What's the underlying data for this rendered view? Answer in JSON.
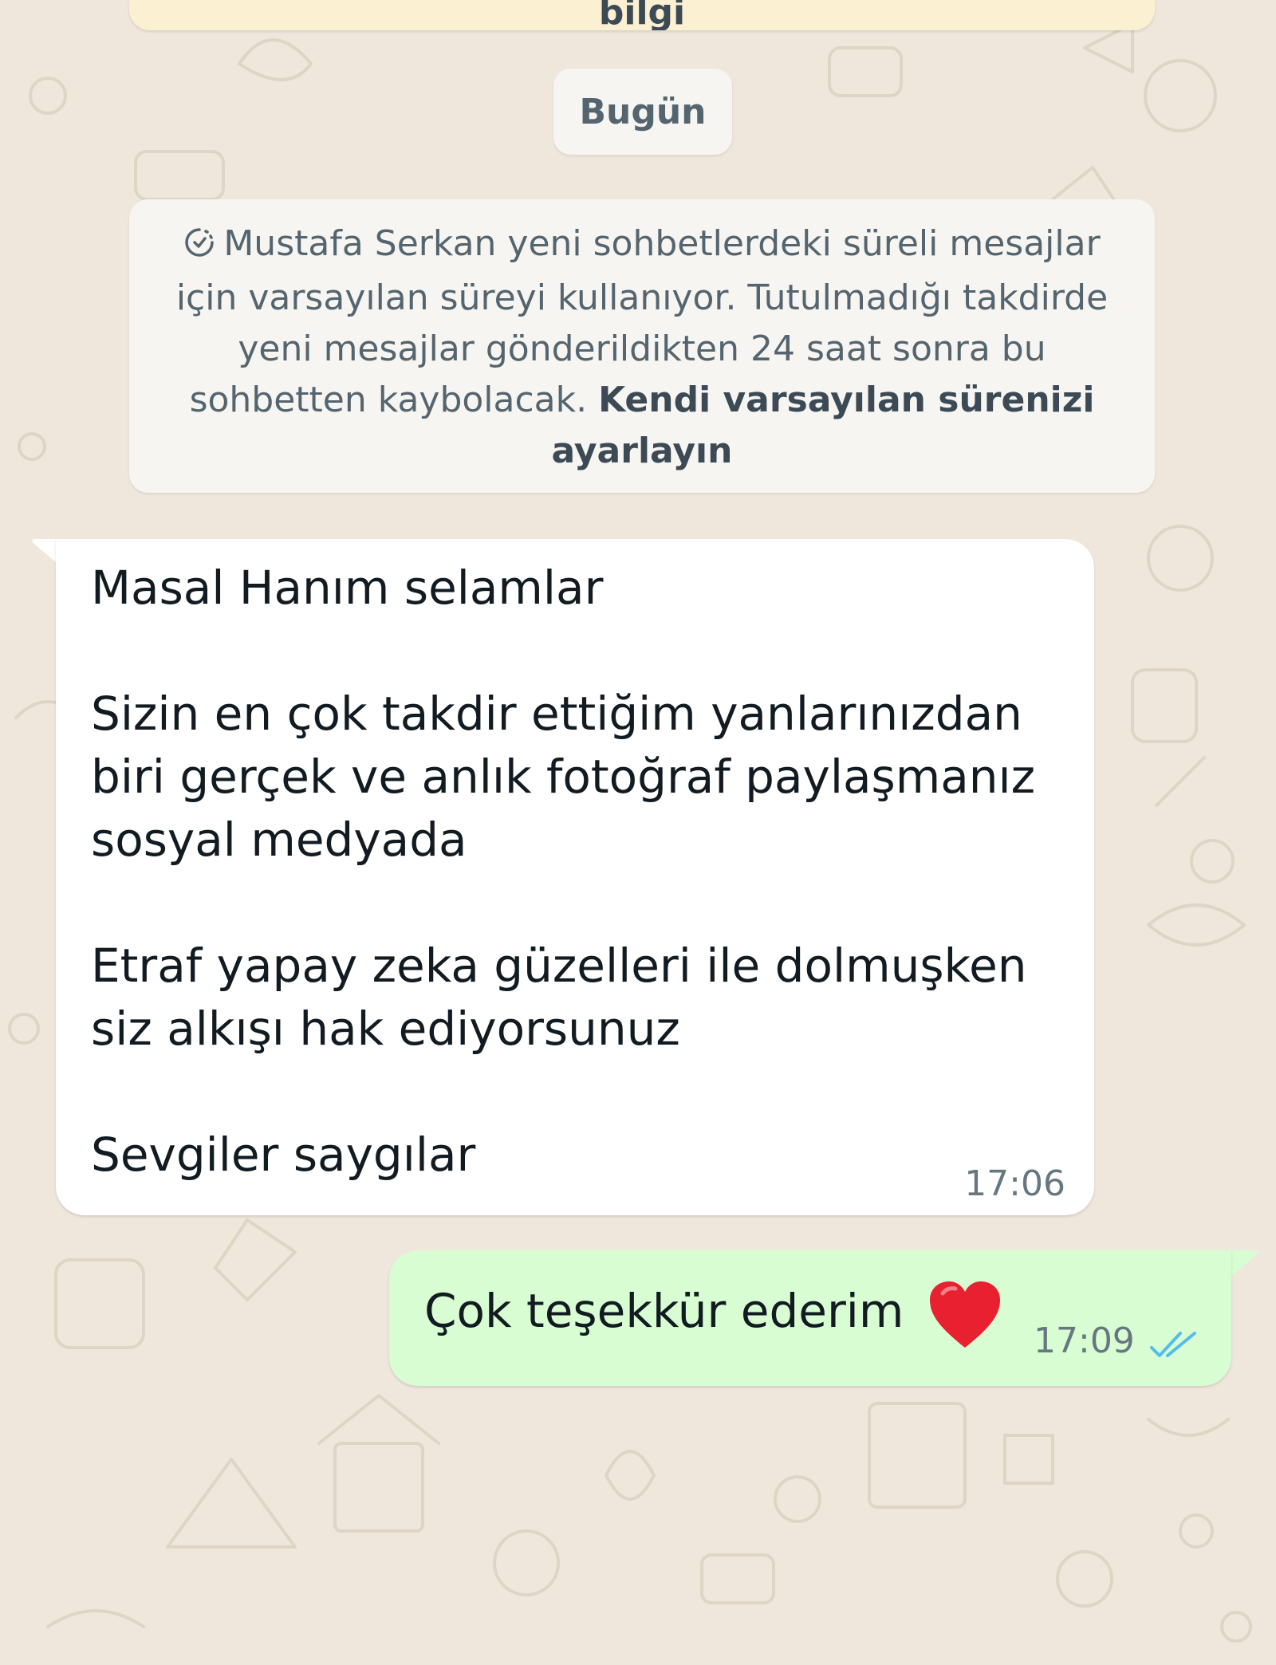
{
  "banner": {
    "text": "bilgi"
  },
  "date_chip": {
    "label": "Bugün"
  },
  "system_notice": {
    "icon": "disappearing-timer-icon",
    "text": "Mustafa Serkan yeni sohbetlerdeki süreli mesajlar için varsayılan süreyi kullanıyor. Tutulmadığı takdirde yeni mesajlar gönderildikten 24 saat sonra bu sohbetten kaybolacak.",
    "link": "Kendi varsayılan sürenizi ayarlayın"
  },
  "messages": [
    {
      "direction": "incoming",
      "text": "Masal Hanım selamlar\n\nSizin en çok takdir ettiğim yanlarınızdan biri gerçek ve anlık fotoğraf paylaşmanız sosyal medyada\n\nEtraf yapay zeka güzelleri ile dolmuşken siz alkışı hak ediyorsunuz\n\nSevgiler saygılar",
      "time": "17:06"
    },
    {
      "direction": "outgoing",
      "text": "Çok teşekkür ederim",
      "emoji": "heart-icon",
      "time": "17:09",
      "status": "read-double-tick-icon"
    }
  ],
  "colors": {
    "wallpaper": "#efe7dc",
    "incoming_bubble": "#ffffff",
    "outgoing_bubble": "#d9fdd3",
    "read_ticks": "#53bdeb",
    "heart": "#e8202f"
  }
}
